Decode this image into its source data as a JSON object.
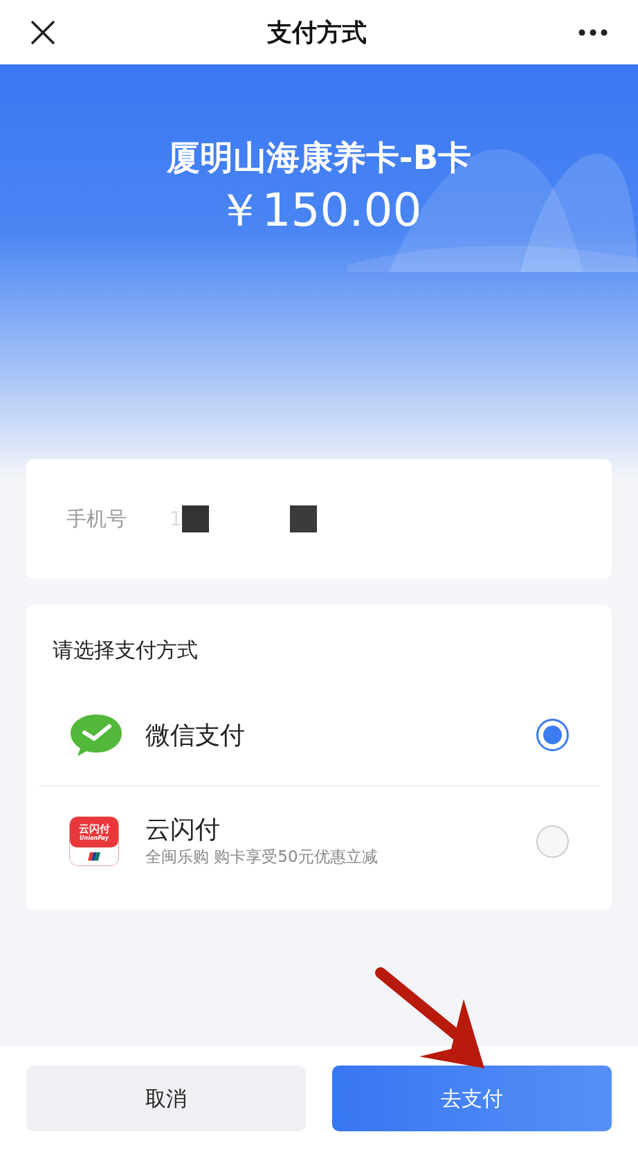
{
  "header": {
    "title": "支付方式"
  },
  "product": {
    "name": "厦明山海康养卡-B卡",
    "price": "￥150.00"
  },
  "phone": {
    "label": "手机号",
    "value": "1"
  },
  "payment": {
    "title": "请选择支付方式",
    "methods": [
      {
        "kind": "wechat",
        "name": "微信支付",
        "selected": true
      },
      {
        "kind": "unionpay",
        "name": "云闪付",
        "logo_text": "云闪付",
        "logo_subtext": "UnionPay",
        "promo": "全闽乐购 购卡享受50元优惠立减",
        "selected": false
      }
    ]
  },
  "buttons": {
    "cancel": "取消",
    "pay": "去支付"
  }
}
